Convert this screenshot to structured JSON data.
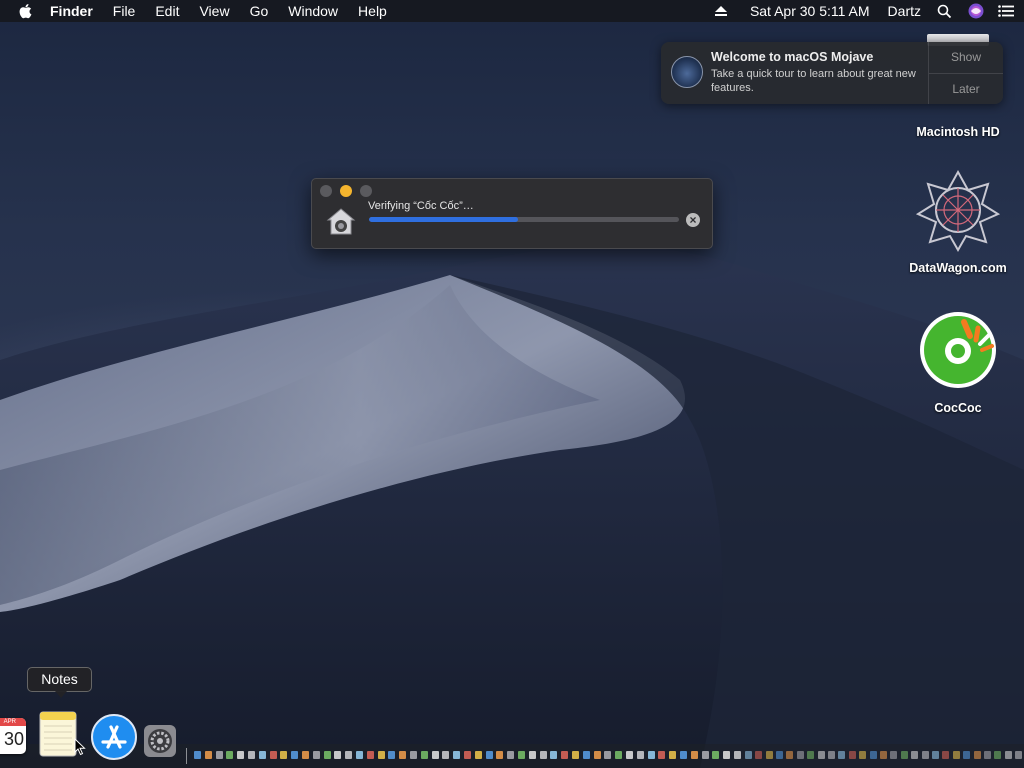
{
  "menubar": {
    "app_name": "Finder",
    "menus": [
      "File",
      "Edit",
      "View",
      "Go",
      "Window",
      "Help"
    ],
    "datetime": "Sat Apr 30  5:11 AM",
    "user": "Dartz"
  },
  "notification": {
    "title": "Welcome to macOS Mojave",
    "body": "Take a quick tour to learn about great new features.",
    "show_label": "Show",
    "later_label": "Later"
  },
  "desktop": {
    "icons": [
      "Macintosh HD",
      "DataWagon.com",
      "CocCoc"
    ]
  },
  "dialog": {
    "message": "Verifying “Cốc Cốc”…",
    "progress": 0.48
  },
  "dock": {
    "tooltip": "Notes",
    "calendar": {
      "month": "APR",
      "day": "30"
    }
  },
  "colors": {
    "progress_fill": "#2f6fe0",
    "traffic_close": "#5a5a5e",
    "traffic_minimize": "#f5b52e",
    "traffic_zoom": "#5a5a5e",
    "coccoc_green": "#45b52f",
    "coccoc_orange": "#f47b20"
  },
  "icons": [
    "apple-icon",
    "eject-icon",
    "search-icon",
    "siri-icon",
    "notification-center-icon",
    "hard-drive-icon",
    "installer-icon",
    "cancel-icon"
  ]
}
